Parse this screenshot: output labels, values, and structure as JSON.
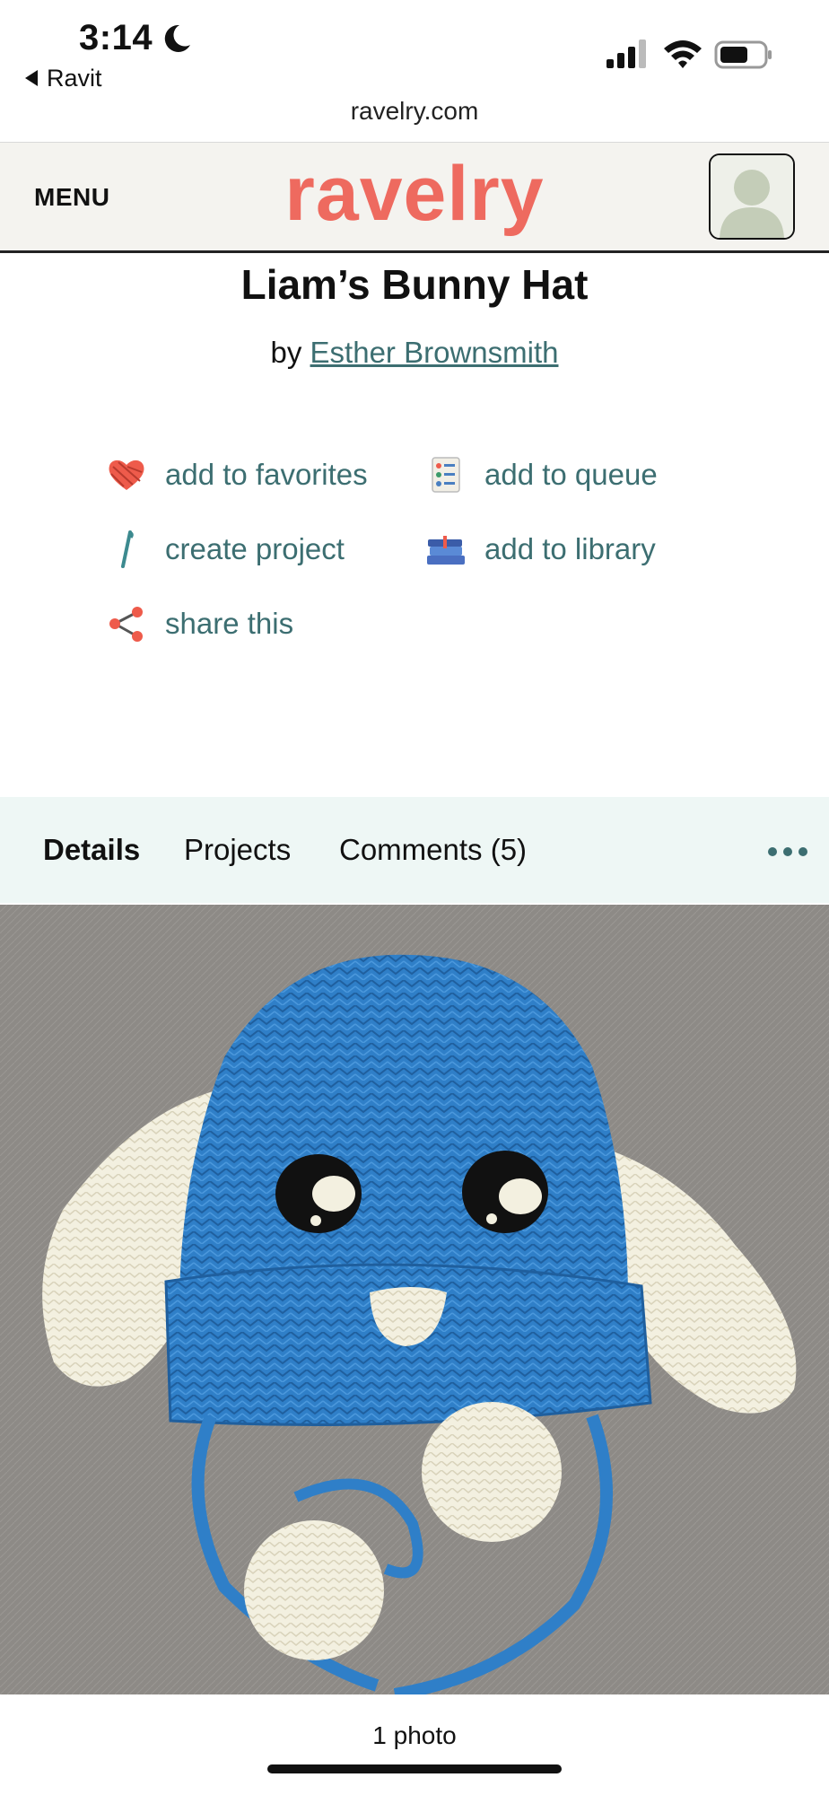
{
  "status": {
    "time": "3:14",
    "back_app": "Ravit",
    "url": "ravelry.com"
  },
  "header": {
    "menu_label": "MENU",
    "logo_text": "ravelry",
    "logo_color": "#ee6a5f"
  },
  "pattern": {
    "title": "Liam’s Bunny Hat",
    "by_prefix": "by",
    "author": "Esther Brownsmith"
  },
  "actions": [
    {
      "label": "add to favorites",
      "icon": "yarn-heart-icon"
    },
    {
      "label": "add to queue",
      "icon": "queue-list-icon"
    },
    {
      "label": "create project",
      "icon": "crochet-hook-icon"
    },
    {
      "label": "add to library",
      "icon": "books-icon"
    },
    {
      "label": "share this",
      "icon": "share-icon"
    }
  ],
  "tabs": [
    {
      "label": "Details",
      "active": true
    },
    {
      "label": "Projects",
      "active": false
    },
    {
      "label": "Comments (5)",
      "active": false
    }
  ],
  "photo": {
    "caption": "1 photo"
  },
  "colors": {
    "accent_teal": "#3c6e71",
    "tab_bar_bg": "#eef7f5",
    "header_bg": "#f4f3ef"
  }
}
